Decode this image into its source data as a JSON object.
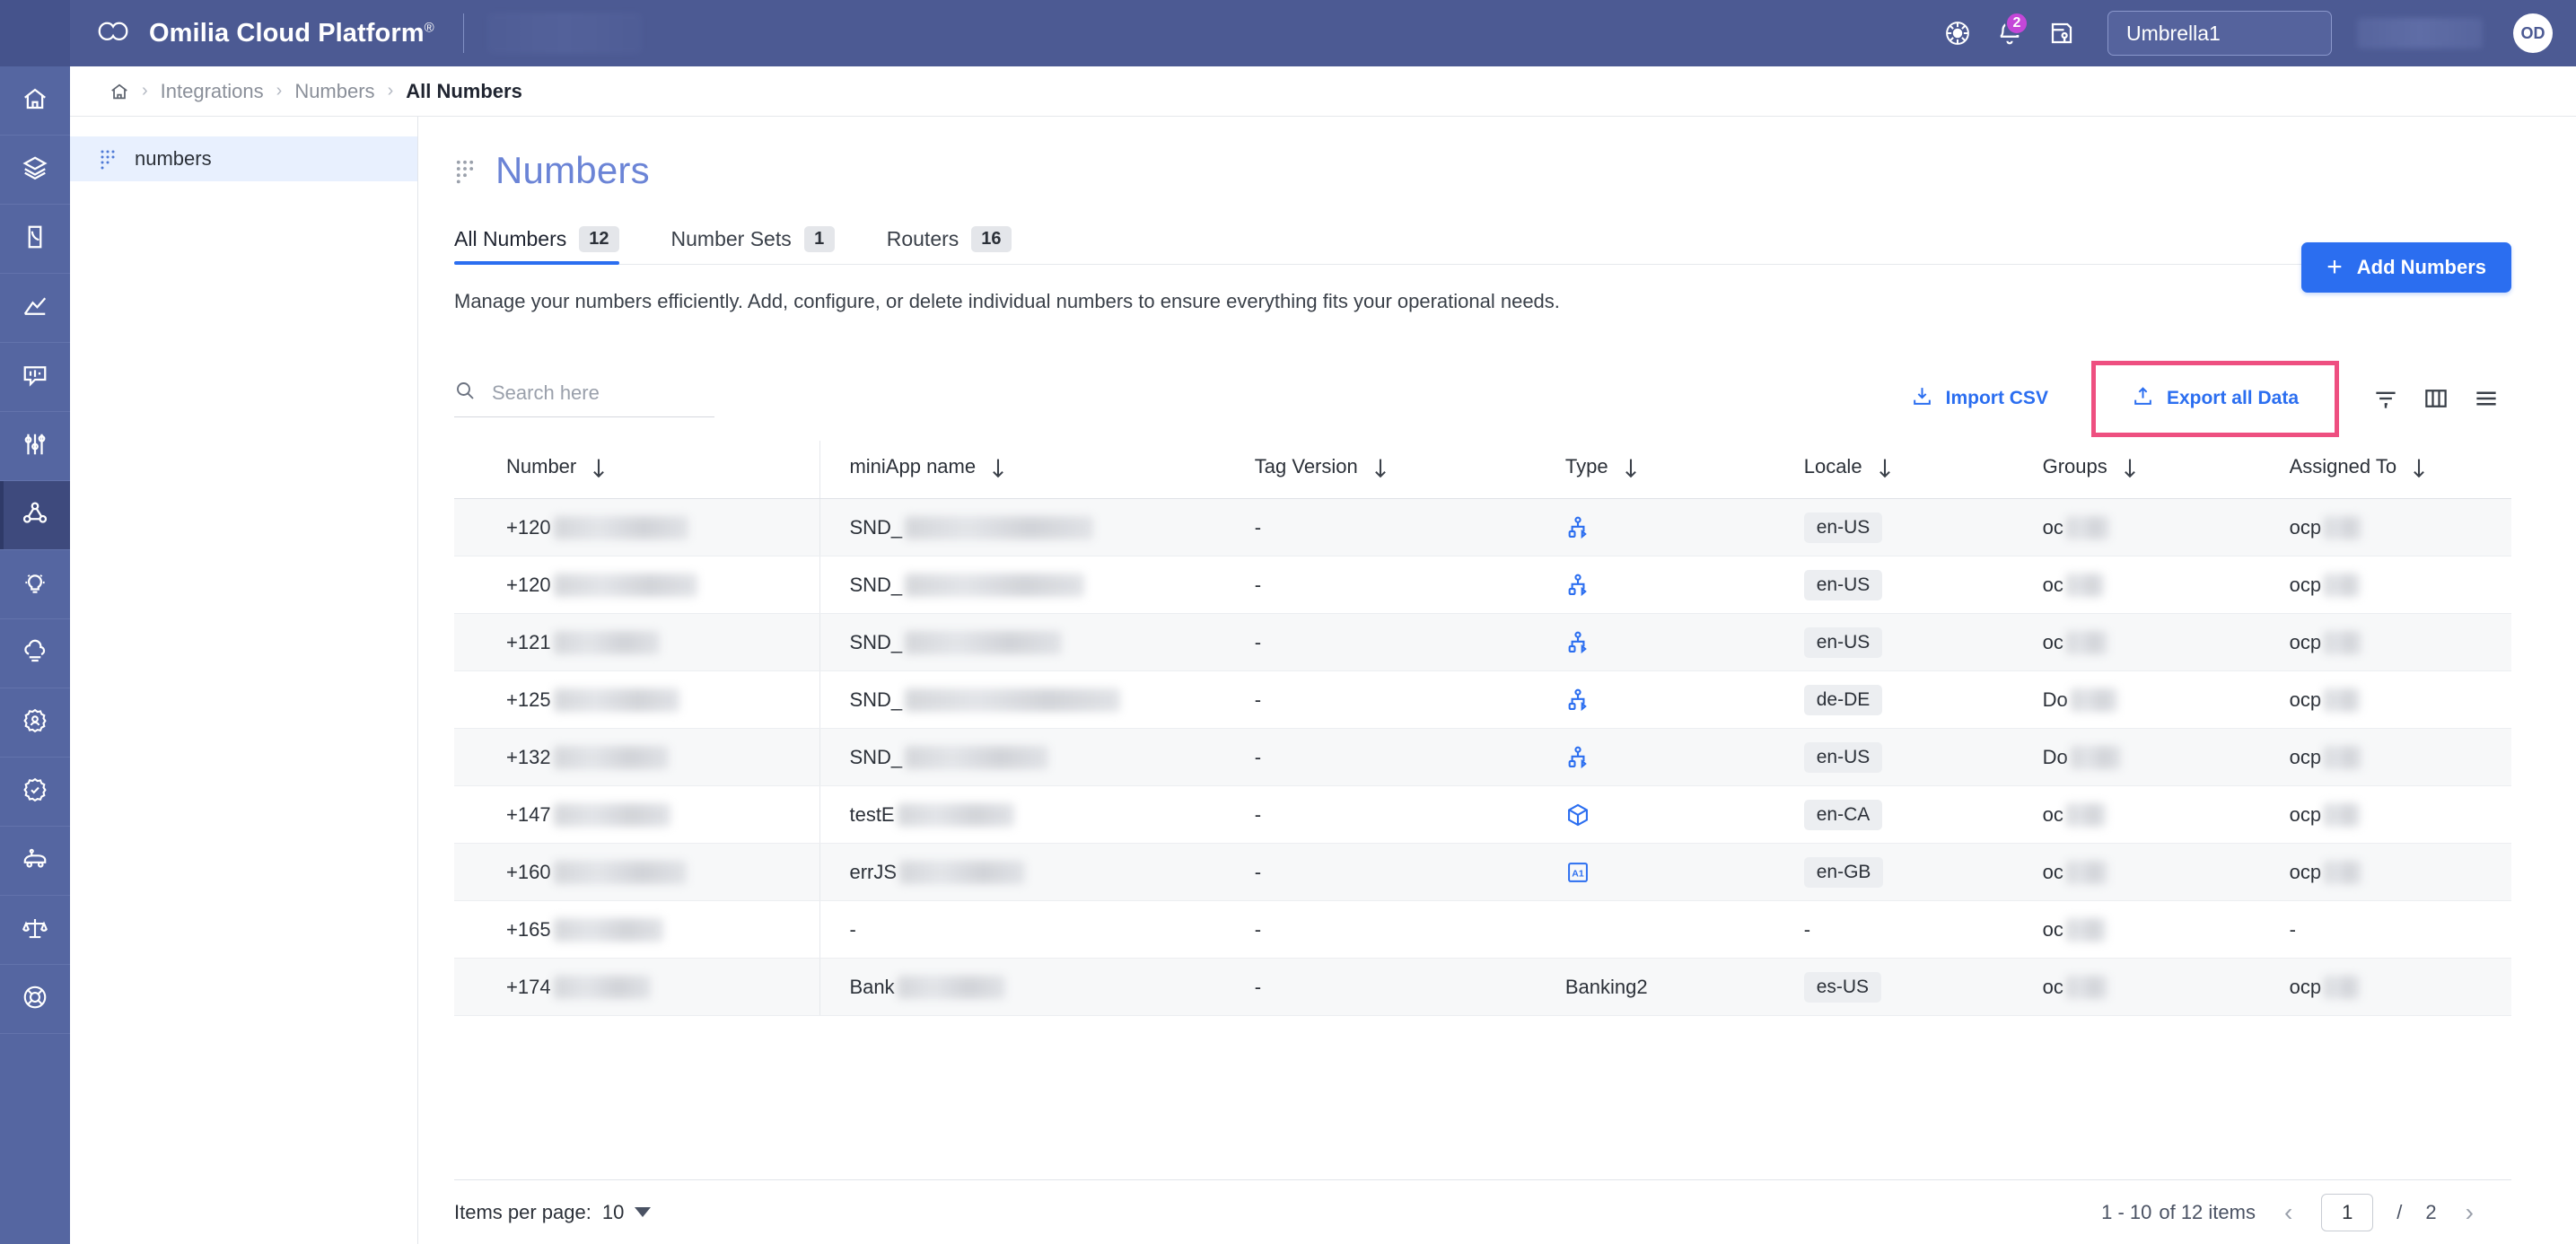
{
  "topbar": {
    "brand": "Omilia Cloud Platform",
    "brand_mark": "®",
    "theme_icon": "sun-icon",
    "notifications_icon": "bell-icon",
    "notifications_count": "2",
    "license_icon": "license-key-icon",
    "tenant": "Umbrella1",
    "avatar_initials": "OD"
  },
  "rail": {
    "items": [
      {
        "icon": "home-icon",
        "active": false
      },
      {
        "icon": "layers-icon",
        "active": false
      },
      {
        "icon": "call-icon",
        "active": false
      },
      {
        "icon": "analytics-icon",
        "active": false
      },
      {
        "icon": "conversation-icon",
        "active": false
      },
      {
        "icon": "tuning-sliders-icon",
        "active": false
      },
      {
        "icon": "integrations-network-icon",
        "active": true
      },
      {
        "icon": "lightbulb-icon",
        "active": false
      },
      {
        "icon": "cloud-icon",
        "active": false
      },
      {
        "icon": "user-badge-icon",
        "active": false
      },
      {
        "icon": "verified-badge-icon",
        "active": false
      },
      {
        "icon": "bot-icon",
        "active": false
      },
      {
        "icon": "scales-icon",
        "active": false
      },
      {
        "icon": "lifebuoy-icon",
        "active": false
      }
    ]
  },
  "breadcrumb": {
    "home_icon": "home-icon",
    "items": [
      "Integrations",
      "Numbers",
      "All Numbers"
    ],
    "separator": "›"
  },
  "tree": {
    "items": [
      {
        "label": "numbers",
        "icon": "grip-dots-icon",
        "selected": true
      }
    ]
  },
  "page": {
    "grip_icon": "grip-dots-icon",
    "title": "Numbers",
    "subtitle": "Manage your numbers efficiently. Add, configure, or delete individual numbers to ensure everything fits your operational needs.",
    "add_button": {
      "label": "Add Numbers",
      "icon": "plus-icon"
    },
    "tabs": [
      {
        "label": "All Numbers",
        "count": "12",
        "active": true
      },
      {
        "label": "Number Sets",
        "count": "1",
        "active": false
      },
      {
        "label": "Routers",
        "count": "16",
        "active": false
      }
    ]
  },
  "toolbar": {
    "search": {
      "icon": "search-icon",
      "value": "",
      "placeholder": "Search here"
    },
    "import_csv": {
      "label": "Import CSV",
      "icon": "download-icon"
    },
    "export_all": {
      "label": "Export all Data",
      "icon": "upload-icon",
      "highlighted": true,
      "highlight_color": "#ee4f80"
    },
    "filter_icon": "filter-icon",
    "columns_icon": "columns-icon",
    "menu_icon": "list-menu-icon"
  },
  "table": {
    "columns": [
      {
        "label": "Number",
        "sort_icon": "sort-down-icon"
      },
      {
        "label": "miniApp name",
        "sort_icon": "sort-down-icon"
      },
      {
        "label": "Tag Version",
        "sort_icon": "sort-down-icon"
      },
      {
        "label": "Type",
        "sort_icon": "sort-down-icon"
      },
      {
        "label": "Locale",
        "sort_icon": "sort-down-icon"
      },
      {
        "label": "Groups",
        "sort_icon": "sort-down-icon"
      },
      {
        "label": "Assigned To",
        "sort_icon": "sort-down-icon"
      }
    ],
    "rows": [
      {
        "number": "+120",
        "number_masked": true,
        "miniapp": "SND_",
        "miniapp_masked": true,
        "tag_version": "-",
        "type": "",
        "type_icon": "hierarchy-icon",
        "locale": "en-US",
        "groups": "oc",
        "groups_masked": true,
        "assigned_to": "ocp",
        "assigned_masked": true
      },
      {
        "number": "+120",
        "number_masked": true,
        "miniapp": "SND_",
        "miniapp_masked": true,
        "tag_version": "-",
        "type": "",
        "type_icon": "hierarchy-icon",
        "locale": "en-US",
        "groups": "oc",
        "groups_masked": true,
        "assigned_to": "ocp",
        "assigned_masked": true
      },
      {
        "number": "+121",
        "number_masked": true,
        "miniapp": "SND_",
        "miniapp_masked": true,
        "tag_version": "-",
        "type": "",
        "type_icon": "hierarchy-icon",
        "locale": "en-US",
        "groups": "oc",
        "groups_masked": true,
        "assigned_to": "ocp",
        "assigned_masked": true
      },
      {
        "number": "+125",
        "number_masked": true,
        "miniapp": "SND_",
        "miniapp_masked": true,
        "tag_version": "-",
        "type": "",
        "type_icon": "hierarchy-icon",
        "locale": "de-DE",
        "groups": "Do",
        "groups_masked": true,
        "assigned_to": "ocp",
        "assigned_masked": true
      },
      {
        "number": "+132",
        "number_masked": true,
        "miniapp": "SND_",
        "miniapp_masked": true,
        "tag_version": "-",
        "type": "",
        "type_icon": "hierarchy-icon",
        "locale": "en-US",
        "groups": "Do",
        "groups_masked": true,
        "assigned_to": "ocp",
        "assigned_masked": true
      },
      {
        "number": "+147",
        "number_masked": true,
        "miniapp": "testE",
        "miniapp_masked": true,
        "tag_version": "-",
        "type": "",
        "type_icon": "cube-icon",
        "locale": "en-CA",
        "groups": "oc",
        "groups_masked": true,
        "assigned_to": "ocp",
        "assigned_masked": true
      },
      {
        "number": "+160",
        "number_masked": true,
        "miniapp": "errJS",
        "miniapp_masked": true,
        "tag_version": "-",
        "type": "",
        "type_icon": "a1-box-icon",
        "locale": "en-GB",
        "groups": "oc",
        "groups_masked": true,
        "assigned_to": "ocp",
        "assigned_masked": true
      },
      {
        "number": "+165",
        "number_masked": true,
        "miniapp": "-",
        "miniapp_masked": false,
        "tag_version": "-",
        "type": "",
        "type_icon": "",
        "locale": "-",
        "groups": "oc",
        "groups_masked": true,
        "assigned_to": "-",
        "assigned_masked": false
      },
      {
        "number": "+174",
        "number_masked": true,
        "miniapp": "Bank",
        "miniapp_masked": true,
        "tag_version": "-",
        "type": "Banking2",
        "type_icon": "",
        "locale": "es-US",
        "groups": "oc",
        "groups_masked": true,
        "assigned_to": "ocp",
        "assigned_masked": true
      }
    ]
  },
  "footer": {
    "items_per_page_label": "Items per page:",
    "items_per_page_value": "10",
    "range_text": "1 - 10",
    "of_text": "of 12 items",
    "prev_icon": "chevron-left-icon",
    "next_icon": "chevron-right-icon",
    "current_page": "1",
    "page_separator": "/",
    "total_pages": "2"
  },
  "colors": {
    "accent": "#2b6ef0",
    "topbar": "#4c5a93",
    "rail": "#5566a1",
    "highlight": "#ee4f80",
    "title": "#6b84d6"
  }
}
